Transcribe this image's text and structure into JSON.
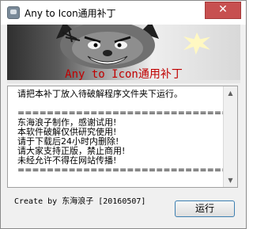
{
  "window": {
    "title": "Any to Icon通用补丁",
    "close_label": "✕"
  },
  "banner": {
    "title": "Any to Icon通用补丁"
  },
  "log": {
    "lines": [
      "请把本补丁放入待破解程序文件夹下运行。",
      "",
      "================================",
      "东海浪子制作，感谢试用!",
      "本软件破解仅供研究使用!",
      "请于下载后24小时内删除!",
      "请大家支持正版，禁止商用!",
      "未经允许不得在网站传播!",
      "================================"
    ]
  },
  "footer": {
    "credit": "Create by 东海浪子 [20160507]",
    "run_button": "运行"
  },
  "icons": [
    "app-icon",
    "close-icon",
    "wolf-banner-image",
    "scroll-up-arrow-icon",
    "scroll-down-arrow-icon"
  ]
}
